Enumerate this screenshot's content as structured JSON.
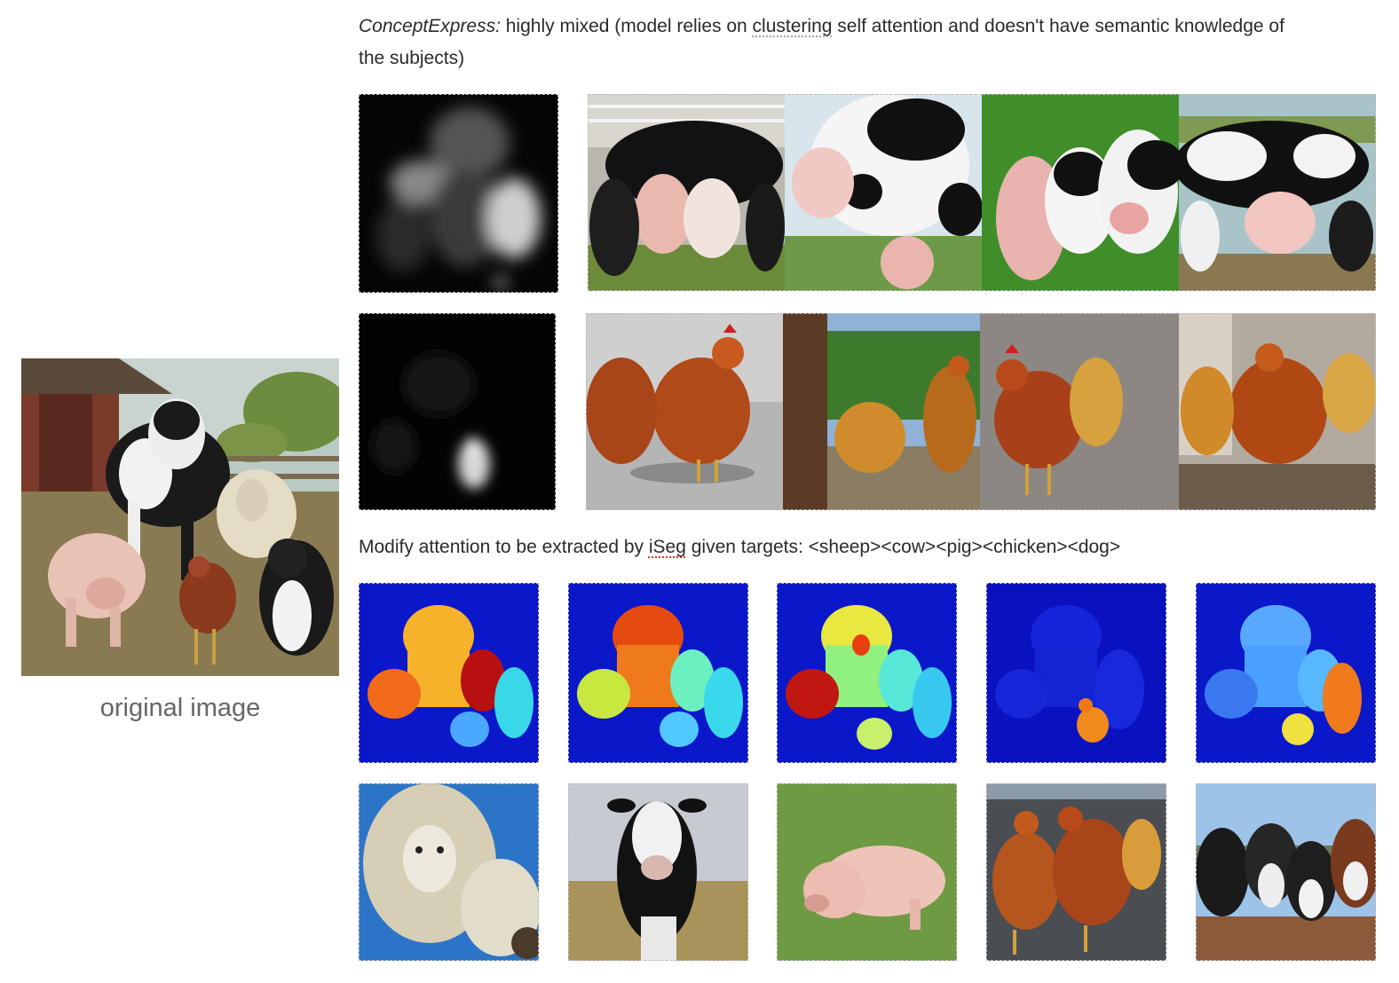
{
  "header": {
    "method_name": "ConceptExpress:",
    "line1_before": " highly mixed (model relies on ",
    "line1_word": "clustering",
    "line1_after": " self attention and doesn't have semantic knowledge of",
    "line2": "the subjects)"
  },
  "original": {
    "label": "original image"
  },
  "iseg_caption": {
    "before": "Modify attention to be extracted by ",
    "word": "iSeg",
    "after": " given targets: <sheep><cow><pig><chicken><dog>"
  }
}
